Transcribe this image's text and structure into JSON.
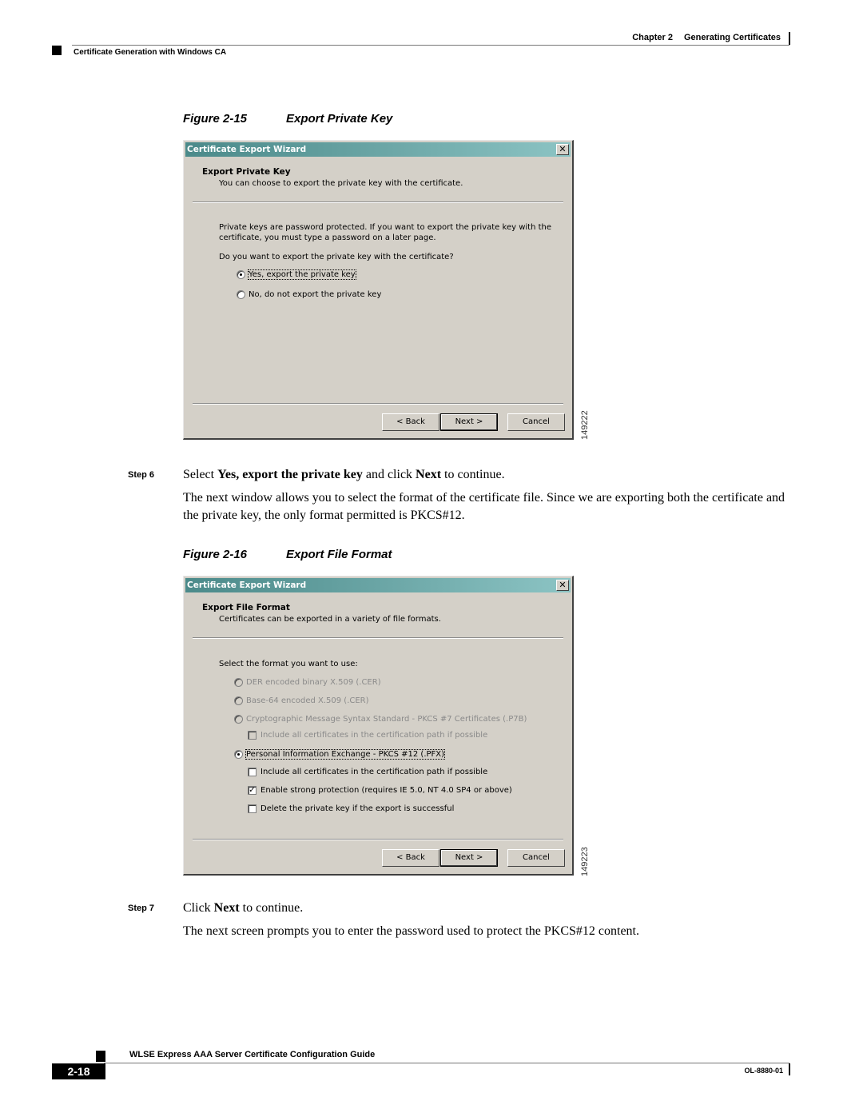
{
  "header": {
    "chapter_label": "Chapter 2",
    "chapter_title": "Generating Certificates",
    "section_title": "Certificate Generation with Windows CA"
  },
  "figure1": {
    "number": "Figure 2-15",
    "title": "Export Private Key",
    "image_id": "149222",
    "dialog": {
      "window_title": "Certificate Export Wizard",
      "close_glyph": "✕",
      "heading": "Export Private Key",
      "subheading": "You can choose to export the private key with the certificate.",
      "paragraph": "Private keys are password protected. If you want to export the private key with the certificate, you must type a password on a later page.",
      "question": "Do you want to export the private key with the certificate?",
      "options": [
        {
          "label": "Yes, export the private key",
          "selected": true
        },
        {
          "label": "No, do not export the private key",
          "selected": false
        }
      ],
      "buttons": {
        "back": "< Back",
        "next": "Next >",
        "cancel": "Cancel"
      }
    }
  },
  "step6": {
    "label": "Step 6",
    "instruction_pre": "Select ",
    "instruction_bold1": "Yes, export the private key",
    "instruction_mid": " and click ",
    "instruction_bold2": "Next",
    "instruction_post": " to continue.",
    "explanation": "The next window allows you to select the format of the certificate file. Since we are exporting both the certificate and the private key, the only format permitted is PKCS#12."
  },
  "figure2": {
    "number": "Figure 2-16",
    "title": "Export File Format",
    "image_id": "149223",
    "dialog": {
      "window_title": "Certificate Export Wizard",
      "close_glyph": "✕",
      "heading": "Export File Format",
      "subheading": "Certificates can be exported in a variety of file formats.",
      "prompt": "Select the format you want to use:",
      "formats": [
        {
          "label": "DER encoded binary X.509 (.CER)",
          "selected": false,
          "enabled": false
        },
        {
          "label": "Base-64 encoded X.509 (.CER)",
          "selected": false,
          "enabled": false
        },
        {
          "label": "Cryptographic Message Syntax Standard - PKCS #7 Certificates (.P7B)",
          "selected": false,
          "enabled": false
        },
        {
          "label": "Personal Information Exchange - PKCS #12 (.PFX)",
          "selected": true,
          "enabled": true
        }
      ],
      "p7b_options": [
        {
          "label": "Include all certificates in the certification path if possible",
          "checked": false,
          "enabled": false
        }
      ],
      "pfx_options": [
        {
          "label": "Include all certificates in the certification path if possible",
          "checked": false,
          "enabled": true
        },
        {
          "label": "Enable strong protection (requires IE 5.0, NT 4.0 SP4 or above)",
          "checked": true,
          "enabled": true
        },
        {
          "label": "Delete the private key if the export is successful",
          "checked": false,
          "enabled": true
        }
      ],
      "buttons": {
        "back": "< Back",
        "next": "Next >",
        "cancel": "Cancel"
      }
    }
  },
  "step7": {
    "label": "Step 7",
    "instruction_pre": "Click ",
    "instruction_bold": "Next",
    "instruction_post": " to continue.",
    "explanation": "The next screen prompts you to enter the password used to protect the PKCS#12 content."
  },
  "footer": {
    "guide_title": "WLSE Express AAA Server Certificate Configuration Guide",
    "page_number": "2-18",
    "doc_number": "OL-8880-01"
  }
}
